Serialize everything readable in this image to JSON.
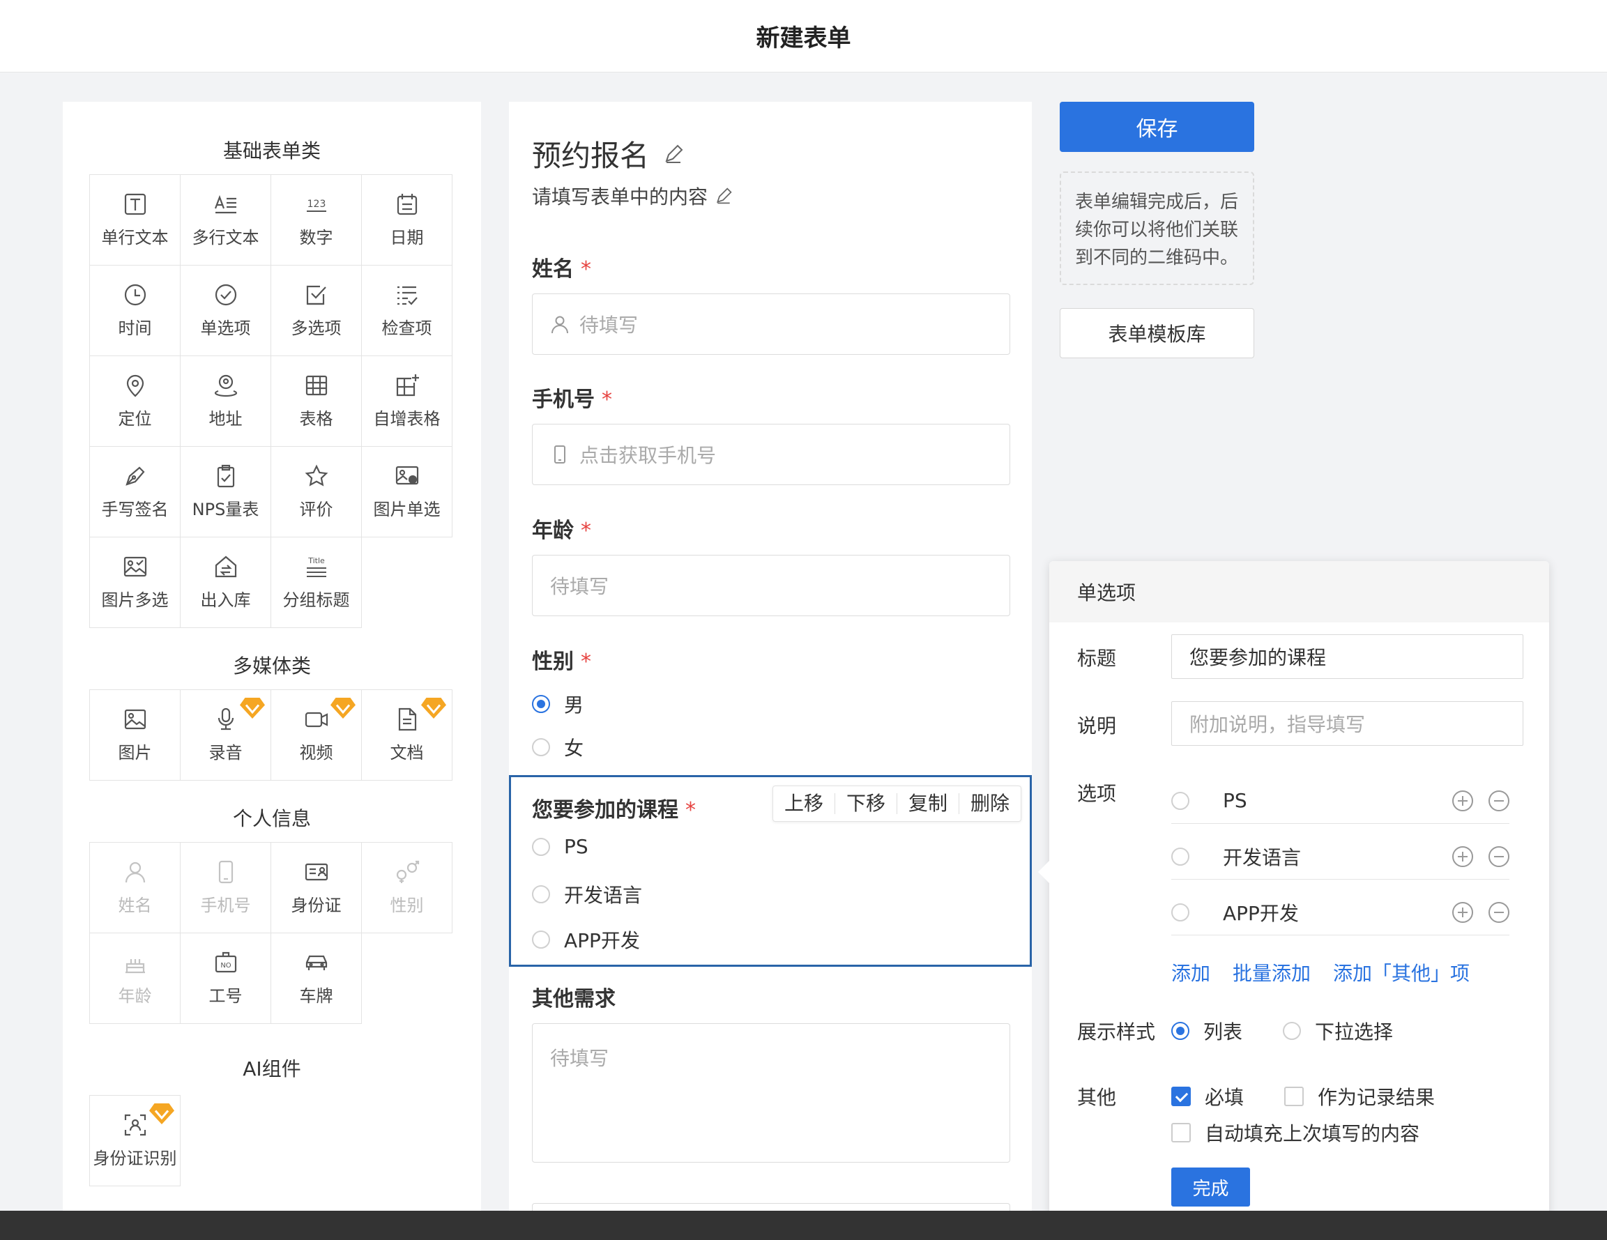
{
  "header": {
    "title": "新建表单"
  },
  "sidebar": {
    "basic": {
      "title": "基础表单类",
      "items": [
        {
          "label": "单行文本",
          "icon": "text-box-icon"
        },
        {
          "label": "多行文本",
          "icon": "multiline-text-icon"
        },
        {
          "label": "数字",
          "icon": "number-icon"
        },
        {
          "label": "日期",
          "icon": "calendar-icon"
        },
        {
          "label": "时间",
          "icon": "clock-icon"
        },
        {
          "label": "单选项",
          "icon": "check-circle-icon"
        },
        {
          "label": "多选项",
          "icon": "checkbox-icon"
        },
        {
          "label": "检查项",
          "icon": "checklist-icon"
        },
        {
          "label": "定位",
          "icon": "location-pin-icon"
        },
        {
          "label": "地址",
          "icon": "address-icon"
        },
        {
          "label": "表格",
          "icon": "table-icon"
        },
        {
          "label": "自增表格",
          "icon": "table-add-icon"
        },
        {
          "label": "手写签名",
          "icon": "pen-icon"
        },
        {
          "label": "NPS量表",
          "icon": "clipboard-icon"
        },
        {
          "label": "评价",
          "icon": "star-icon"
        },
        {
          "label": "图片单选",
          "icon": "image-single-icon"
        },
        {
          "label": "图片多选",
          "icon": "image-multi-icon"
        },
        {
          "label": "出入库",
          "icon": "warehouse-icon"
        },
        {
          "label": "分组标题",
          "icon": "group-title-icon"
        }
      ]
    },
    "media": {
      "title": "多媒体类",
      "items": [
        {
          "label": "图片",
          "icon": "image-icon"
        },
        {
          "label": "录音",
          "icon": "microphone-icon"
        },
        {
          "label": "视频",
          "icon": "video-icon"
        },
        {
          "label": "文档",
          "icon": "document-icon"
        }
      ]
    },
    "personal": {
      "title": "个人信息",
      "items": [
        {
          "label": "姓名",
          "icon": "user-icon"
        },
        {
          "label": "手机号",
          "icon": "phone-icon"
        },
        {
          "label": "身份证",
          "icon": "id-card-icon"
        },
        {
          "label": "性别",
          "icon": "gender-icon"
        },
        {
          "label": "年龄",
          "icon": "cake-icon"
        },
        {
          "label": "工号",
          "icon": "badge-no-icon"
        },
        {
          "label": "车牌",
          "icon": "car-icon"
        }
      ]
    },
    "ai": {
      "title": "AI组件",
      "items": [
        {
          "label": "身份证识别",
          "icon": "id-scan-icon"
        }
      ]
    }
  },
  "form": {
    "title": "预约报名",
    "description": "请填写表单中的内容",
    "required_mark": "*",
    "fields": {
      "name": {
        "label": "姓名",
        "placeholder": "待填写"
      },
      "phone": {
        "label": "手机号",
        "placeholder": "点击获取手机号"
      },
      "age": {
        "label": "年龄",
        "placeholder": "待填写"
      },
      "gender": {
        "label": "性别",
        "options": [
          "男",
          "女"
        ],
        "selected": "男"
      },
      "course": {
        "label": "您要参加的课程",
        "options": [
          "PS",
          "开发语言",
          "APP开发"
        ]
      },
      "other": {
        "label": "其他需求",
        "placeholder": "待填写"
      }
    },
    "toolbar": {
      "up": "上移",
      "down": "下移",
      "copy": "复制",
      "delete": "删除"
    }
  },
  "actions": {
    "save": "保存",
    "tip": "表单编辑完成后，后续你可以将他们关联到不同的二维码中。",
    "template_library": "表单模板库"
  },
  "property_panel": {
    "header": "单选项",
    "title_label": "标题",
    "title_value": "您要参加的课程",
    "desc_label": "说明",
    "desc_placeholder": "附加说明，指导填写",
    "options_label": "选项",
    "options": [
      "PS",
      "开发语言",
      "APP开发"
    ],
    "links": {
      "add": "添加",
      "batch_add": "批量添加",
      "add_other": "添加「其他」项"
    },
    "display_label": "展示样式",
    "display_options": {
      "list": "列表",
      "dropdown": "下拉选择"
    },
    "display_selected": "列表",
    "other_label": "其他",
    "checks": {
      "required": "必填",
      "as_record": "作为记录结果",
      "autofill": "自动填充上次填写的内容"
    },
    "done": "完成"
  },
  "colors": {
    "primary": "#2a73e0",
    "required": "#e64340",
    "selected_border": "#2a64a8",
    "vip": "#f5a623"
  }
}
